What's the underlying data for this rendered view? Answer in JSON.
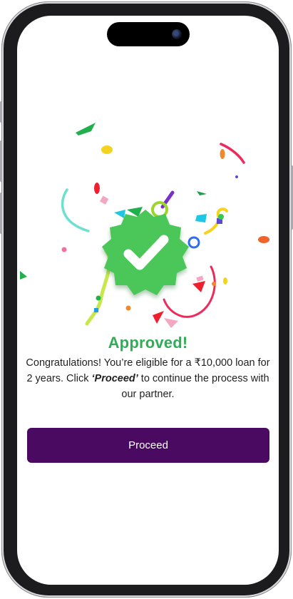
{
  "status": {
    "title": "Approved!",
    "message_part1": "Congratulations! You’re eligible for a ₹10,000 loan for 2 years. Click ",
    "message_emphasis": "‘Proceed’",
    "message_part2": " to continue the process with our partner."
  },
  "actions": {
    "proceed_label": "Proceed"
  },
  "colors": {
    "accent_primary": "#4a0a62",
    "success_green": "#2fae55",
    "badge_green": "#4cc75a"
  },
  "icons": {
    "badge": "check-badge-icon",
    "celebration": "confetti"
  }
}
